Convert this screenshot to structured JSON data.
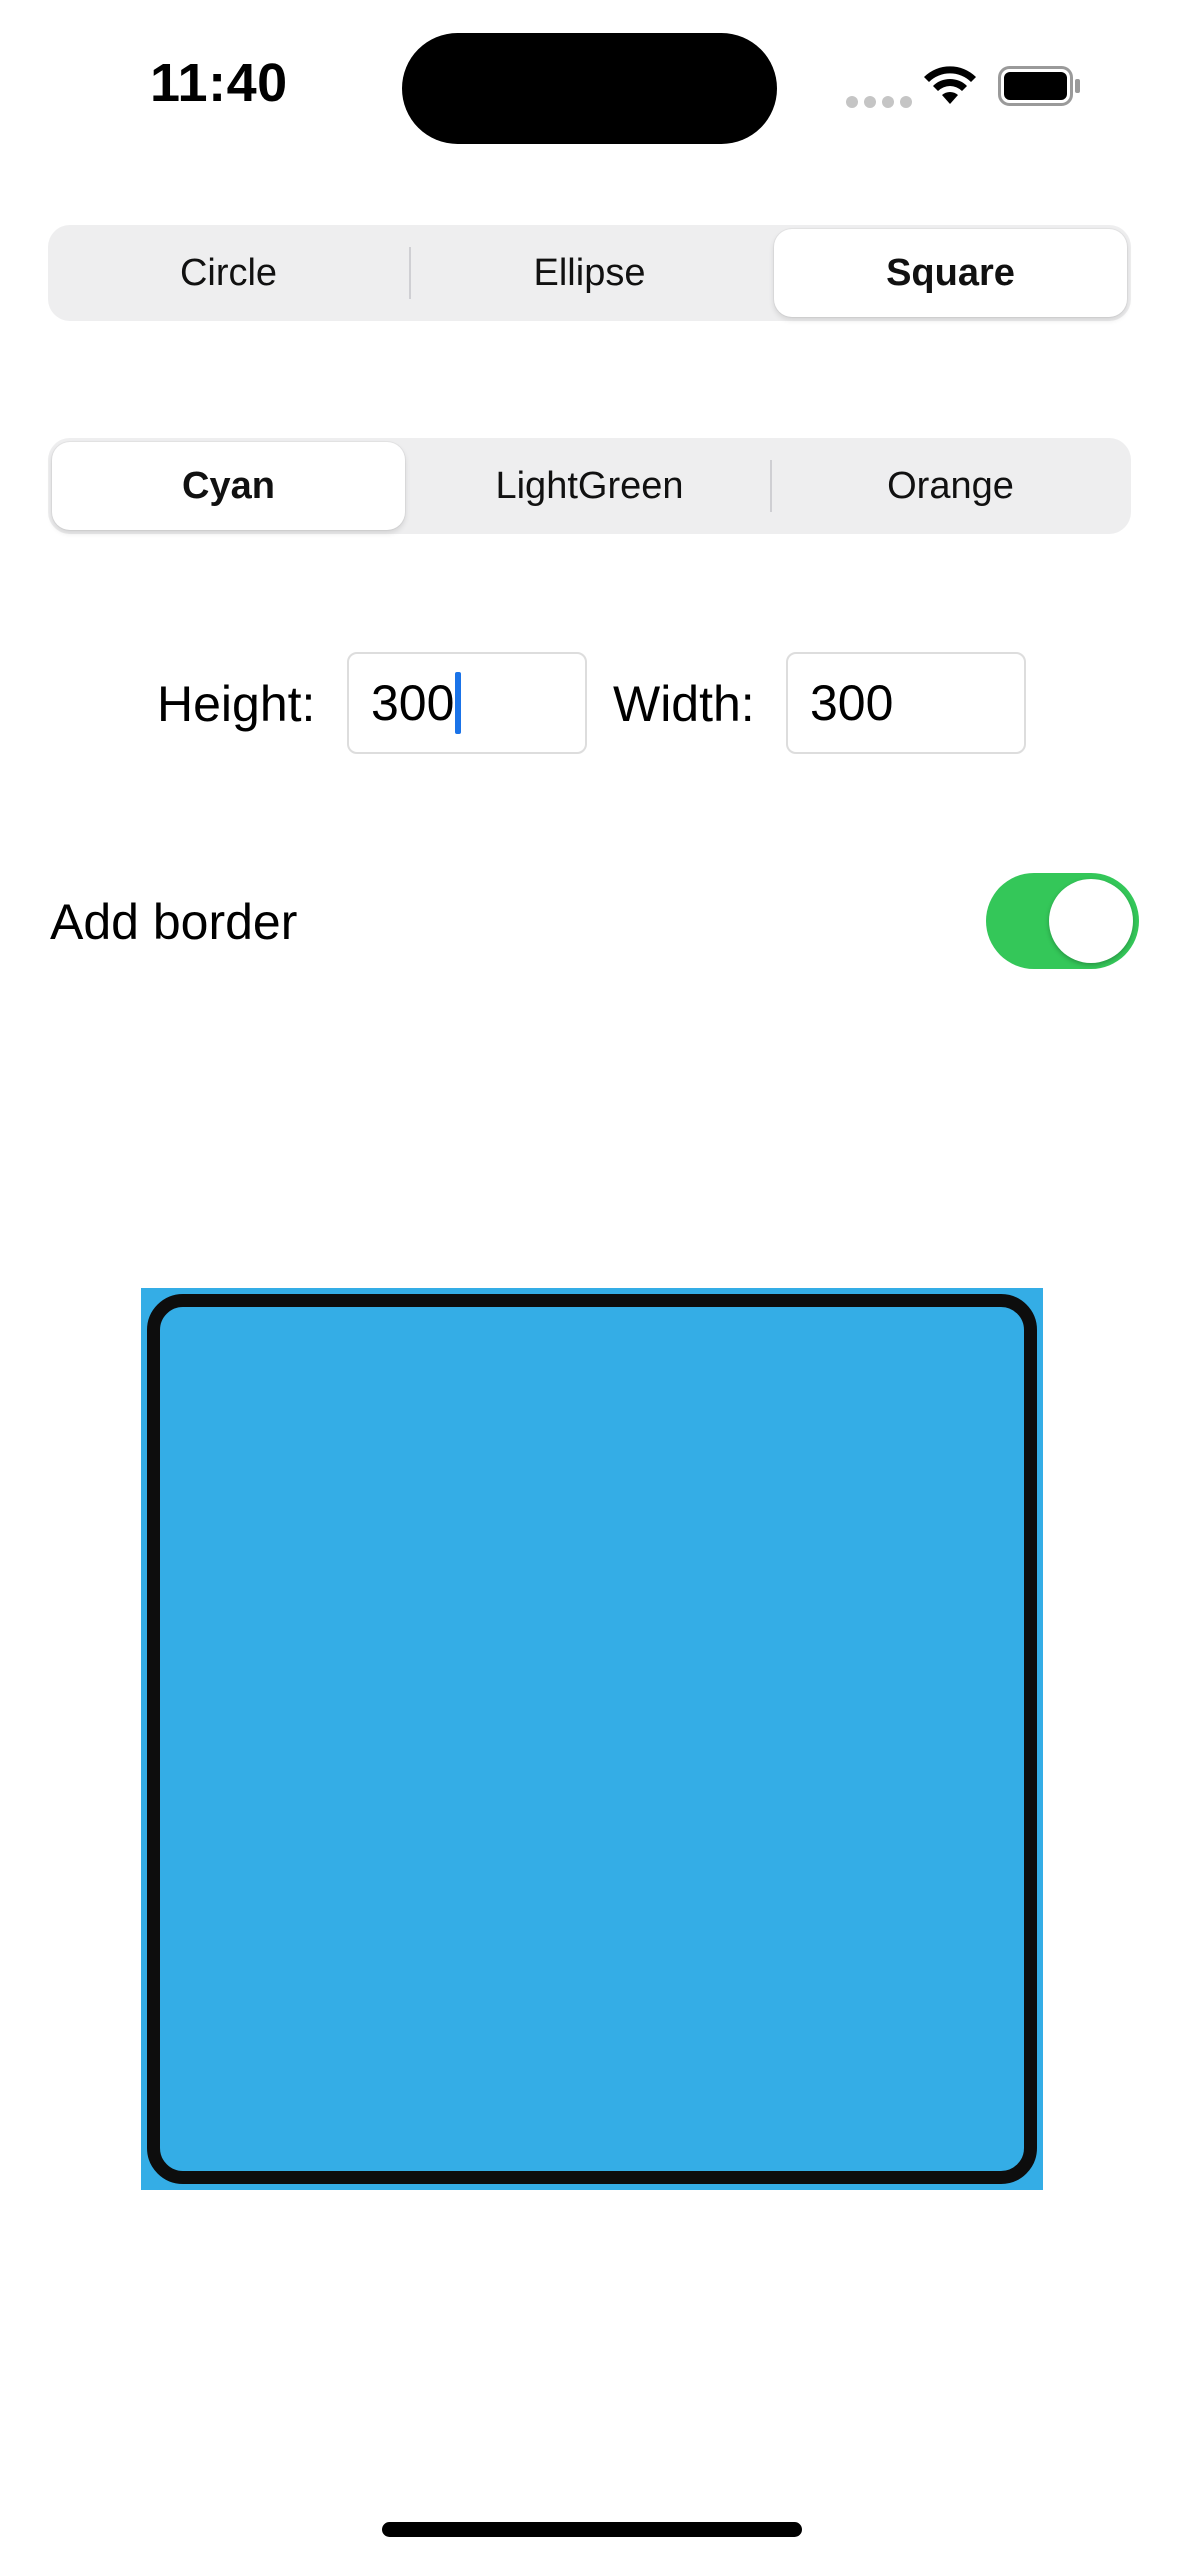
{
  "status_bar": {
    "time": "11:40"
  },
  "shape_picker": {
    "segments": [
      "Circle",
      "Ellipse",
      "Square"
    ],
    "selected": "Square"
  },
  "color_picker": {
    "segments": [
      "Cyan",
      "LightGreen",
      "Orange"
    ],
    "selected": "Cyan"
  },
  "size": {
    "height_label": "Height:",
    "height_value": "300",
    "width_label": "Width:",
    "width_value": "300"
  },
  "border_toggle": {
    "label": "Add border",
    "on": true
  },
  "colors": {
    "shape_fill": "#34ADE6",
    "toggle_on": "#34C759",
    "caret": "#1A73E8",
    "border": "#0D0D0D"
  },
  "icons": {
    "wifi": "wifi-icon",
    "battery": "battery-icon",
    "signal": "signal-dots-icon"
  }
}
